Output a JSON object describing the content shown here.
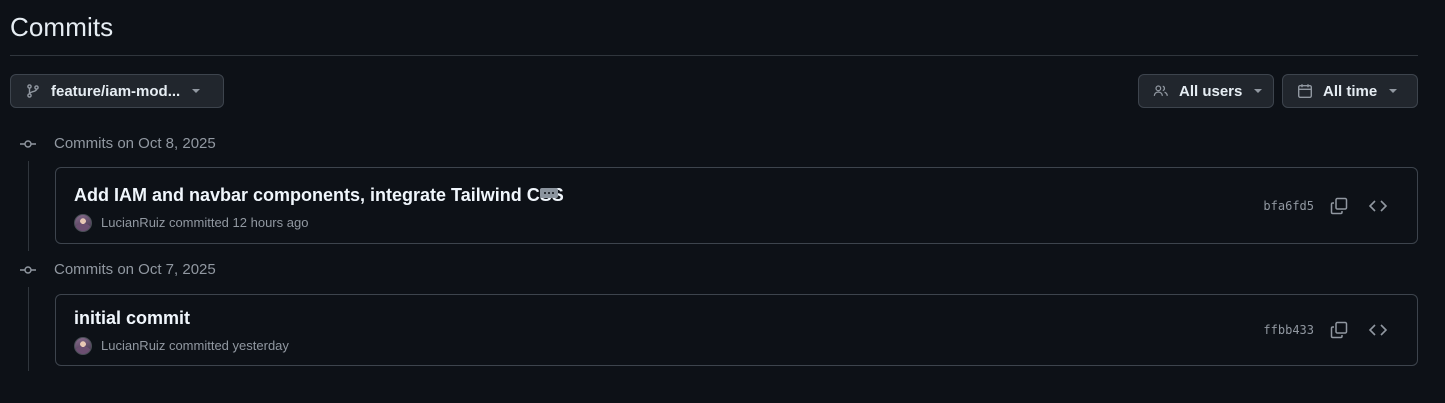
{
  "page": {
    "title": "Commits"
  },
  "filters": {
    "branch": {
      "label": "feature/iam-mod...",
      "icon": "git-branch-icon"
    },
    "users": {
      "label": "All users",
      "icon": "people-icon"
    },
    "time": {
      "label": "All time",
      "icon": "calendar-icon"
    }
  },
  "groups": [
    {
      "heading": "Commits on Oct 8, 2025",
      "commits": [
        {
          "title": "Add IAM and navbar components, integrate Tailwind CSS",
          "author": "LucianRuiz",
          "action": "committed",
          "time": "12 hours ago",
          "sha": "bfa6fd5"
        }
      ]
    },
    {
      "heading": "Commits on Oct 7, 2025",
      "commits": [
        {
          "title": "initial commit",
          "author": "LucianRuiz",
          "action": "committed",
          "time": "yesterday",
          "sha": "ffbb433"
        }
      ]
    }
  ]
}
